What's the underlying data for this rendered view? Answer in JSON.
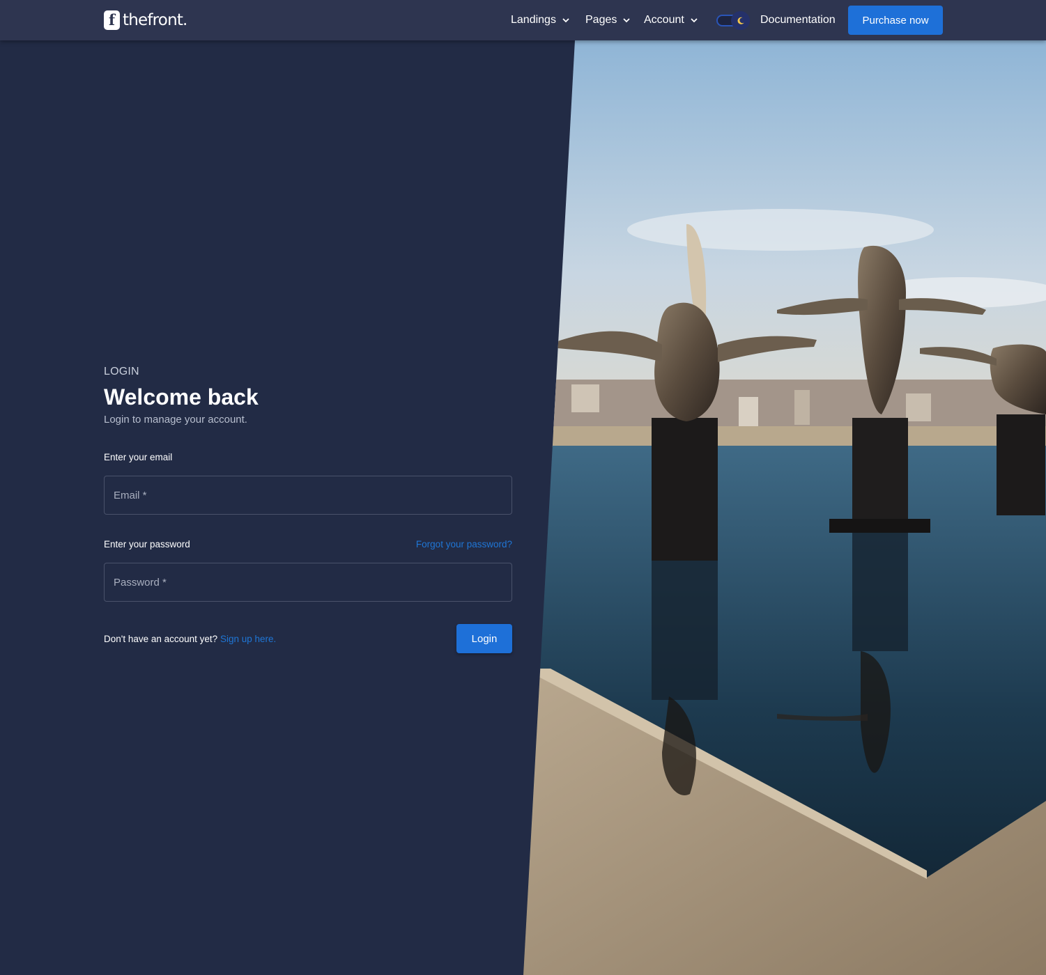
{
  "nav": {
    "logo_mark": "f",
    "logo_text": "thefront.",
    "items": [
      {
        "label": "Landings",
        "has_dropdown": true
      },
      {
        "label": "Pages",
        "has_dropdown": true
      },
      {
        "label": "Account",
        "has_dropdown": true
      }
    ],
    "theme_toggle_icon": "moon-icon",
    "documentation": "Documentation",
    "purchase": "Purchase now"
  },
  "login": {
    "eyebrow": "LOGIN",
    "title": "Welcome back",
    "subtitle": "Login to manage your account.",
    "email_label": "Enter your email",
    "email_placeholder": "Email *",
    "email_value": "",
    "password_label": "Enter your password",
    "password_placeholder": "Password *",
    "password_value": "",
    "forgot": "Forgot your password?",
    "signup_prompt": "Don't have an account yet?",
    "signup_link": "Sign up here.",
    "submit": "Login"
  },
  "colors": {
    "page_bg": "#222b45",
    "navbar_bg": "#2e3550",
    "accent": "#1e70d8",
    "link": "#1f76d6"
  }
}
